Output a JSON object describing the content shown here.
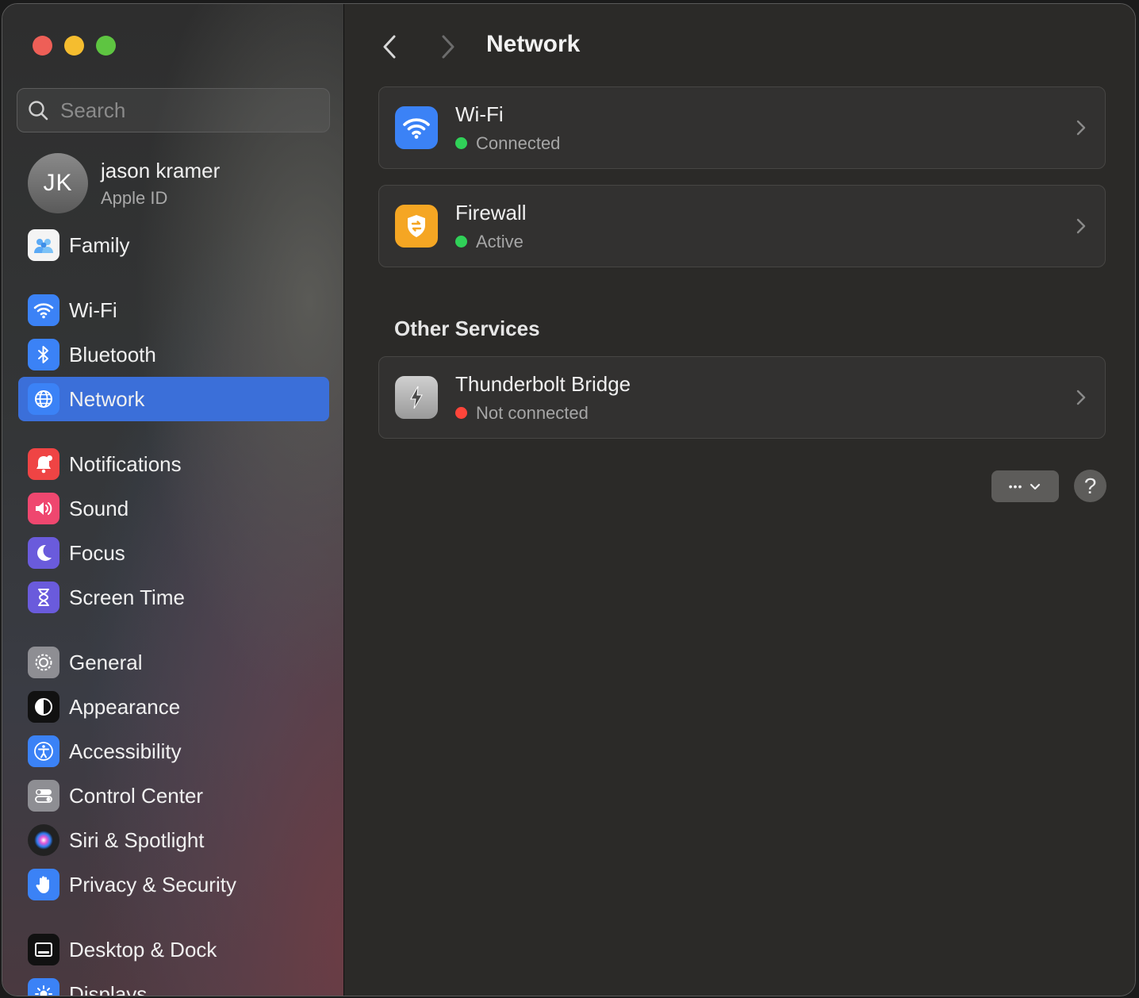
{
  "window": {
    "title": "Network"
  },
  "search": {
    "placeholder": "Search"
  },
  "account": {
    "initials": "JK",
    "name": "jason kramer",
    "subtitle": "Apple ID"
  },
  "sidebar": {
    "items": [
      {
        "label": "Family",
        "icon": "family-icon",
        "color": "#ffffff"
      },
      {
        "label": "Wi-Fi",
        "icon": "wifi-icon",
        "color": "#3b82f6"
      },
      {
        "label": "Bluetooth",
        "icon": "bluetooth-icon",
        "color": "#3b82f6"
      },
      {
        "label": "Network",
        "icon": "globe-icon",
        "color": "#3b82f6",
        "selected": true
      },
      {
        "label": "Notifications",
        "icon": "bell-icon",
        "color": "#ef4444"
      },
      {
        "label": "Sound",
        "icon": "speaker-icon",
        "color": "#ef476f"
      },
      {
        "label": "Focus",
        "icon": "moon-icon",
        "color": "#6a5bdc"
      },
      {
        "label": "Screen Time",
        "icon": "hourglass-icon",
        "color": "#6a5bdc"
      },
      {
        "label": "General",
        "icon": "gear-icon",
        "color": "#8e8e93"
      },
      {
        "label": "Appearance",
        "icon": "appearance-icon",
        "color": "#111111"
      },
      {
        "label": "Accessibility",
        "icon": "accessibility-icon",
        "color": "#3b82f6"
      },
      {
        "label": "Control Center",
        "icon": "toggles-icon",
        "color": "#8e8e93"
      },
      {
        "label": "Siri & Spotlight",
        "icon": "siri-icon",
        "color": "#222222"
      },
      {
        "label": "Privacy & Security",
        "icon": "hand-icon",
        "color": "#3b82f6"
      },
      {
        "label": "Desktop & Dock",
        "icon": "dock-icon",
        "color": "#111111"
      },
      {
        "label": "Displays",
        "icon": "sun-icon",
        "color": "#3b82f6"
      }
    ]
  },
  "main": {
    "services": [
      {
        "title": "Wi-Fi",
        "status": "Connected",
        "status_color": "#30d158",
        "icon": "wifi-icon",
        "icon_color": "#3b82f6"
      },
      {
        "title": "Firewall",
        "status": "Active",
        "status_color": "#30d158",
        "icon": "firewall-shield-icon",
        "icon_color": "#f5a623"
      }
    ],
    "other_title": "Other Services",
    "other_services": [
      {
        "title": "Thunderbolt Bridge",
        "status": "Not connected",
        "status_color": "#ff453a",
        "icon": "thunderbolt-icon",
        "icon_color": "#8e8e93"
      }
    ],
    "more_label": "•••",
    "help_label": "?"
  }
}
